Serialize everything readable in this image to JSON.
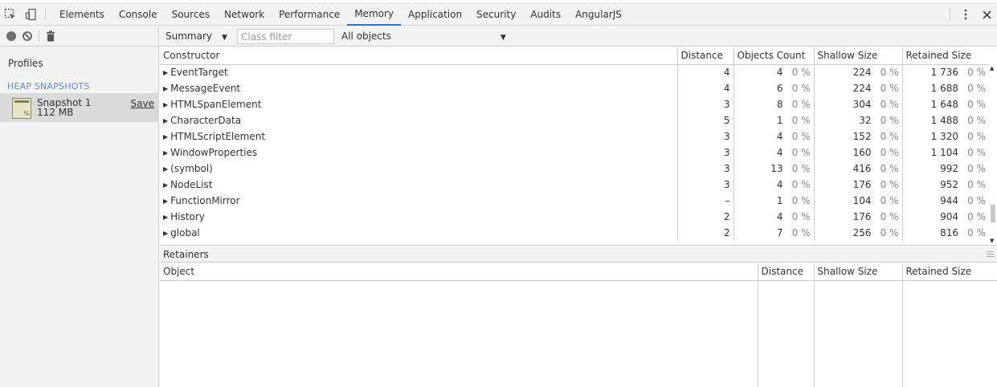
{
  "tabs": [
    "Elements",
    "Console",
    "Sources",
    "Network",
    "Performance",
    "Memory",
    "Application",
    "Security",
    "Audits",
    "AngularJS"
  ],
  "active_tab": "Memory",
  "sidebar": {
    "profiles_label": "Profiles",
    "section_label": "HEAP SNAPSHOTS",
    "snapshot": {
      "name": "Snapshot 1",
      "size": "112 MB",
      "save_label": "Save",
      "icon_glyph": "%"
    }
  },
  "toolbar": {
    "view": "Summary",
    "class_filter_placeholder": "Class filter",
    "objects_filter": "All objects"
  },
  "constructor_table": {
    "headers": [
      "Constructor",
      "Distance",
      "Objects Count",
      "Shallow Size",
      "Retained Size"
    ],
    "rows": [
      {
        "name": "EventTarget",
        "distance": "4",
        "count": "4",
        "count_pct": "0 %",
        "shallow": "224",
        "shallow_pct": "0 %",
        "retained": "1 736",
        "retained_pct": "0 %"
      },
      {
        "name": "MessageEvent",
        "distance": "4",
        "count": "6",
        "count_pct": "0 %",
        "shallow": "224",
        "shallow_pct": "0 %",
        "retained": "1 688",
        "retained_pct": "0 %"
      },
      {
        "name": "HTMLSpanElement",
        "distance": "3",
        "count": "8",
        "count_pct": "0 %",
        "shallow": "304",
        "shallow_pct": "0 %",
        "retained": "1 648",
        "retained_pct": "0 %"
      },
      {
        "name": "CharacterData",
        "distance": "5",
        "count": "1",
        "count_pct": "0 %",
        "shallow": "32",
        "shallow_pct": "0 %",
        "retained": "1 488",
        "retained_pct": "0 %"
      },
      {
        "name": "HTMLScriptElement",
        "distance": "3",
        "count": "4",
        "count_pct": "0 %",
        "shallow": "152",
        "shallow_pct": "0 %",
        "retained": "1 320",
        "retained_pct": "0 %"
      },
      {
        "name": "WindowProperties",
        "distance": "3",
        "count": "4",
        "count_pct": "0 %",
        "shallow": "160",
        "shallow_pct": "0 %",
        "retained": "1 104",
        "retained_pct": "0 %"
      },
      {
        "name": "(symbol)",
        "distance": "3",
        "count": "13",
        "count_pct": "0 %",
        "shallow": "416",
        "shallow_pct": "0 %",
        "retained": "992",
        "retained_pct": "0 %"
      },
      {
        "name": "NodeList",
        "distance": "3",
        "count": "4",
        "count_pct": "0 %",
        "shallow": "176",
        "shallow_pct": "0 %",
        "retained": "952",
        "retained_pct": "0 %"
      },
      {
        "name": "FunctionMirror",
        "distance": "–",
        "count": "1",
        "count_pct": "0 %",
        "shallow": "104",
        "shallow_pct": "0 %",
        "retained": "944",
        "retained_pct": "0 %"
      },
      {
        "name": "History",
        "distance": "2",
        "count": "4",
        "count_pct": "0 %",
        "shallow": "176",
        "shallow_pct": "0 %",
        "retained": "904",
        "retained_pct": "0 %"
      },
      {
        "name": "global",
        "distance": "2",
        "count": "7",
        "count_pct": "0 %",
        "shallow": "256",
        "shallow_pct": "0 %",
        "retained": "816",
        "retained_pct": "0 %"
      }
    ]
  },
  "retainers": {
    "title": "Retainers",
    "headers": [
      "Object",
      "Distance",
      "Shallow Size",
      "Retained Size"
    ]
  }
}
